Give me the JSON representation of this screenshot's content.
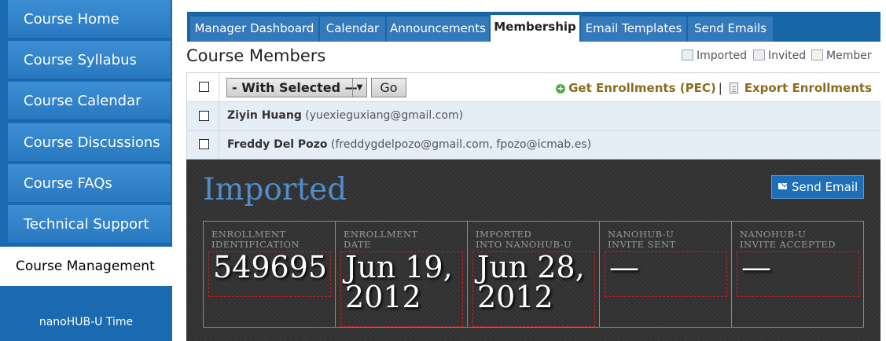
{
  "sidebar": {
    "items": [
      {
        "label": "Course Home"
      },
      {
        "label": "Course Syllabus"
      },
      {
        "label": "Course Calendar"
      },
      {
        "label": "Course Discussions"
      },
      {
        "label": "Course FAQs"
      },
      {
        "label": "Technical Support"
      },
      {
        "label": "Course Management"
      }
    ],
    "footer": "nanoHUB-U Time"
  },
  "tabs": [
    {
      "label": "Manager Dashboard"
    },
    {
      "label": "Calendar"
    },
    {
      "label": "Announcements"
    },
    {
      "label": "Membership"
    },
    {
      "label": "Email Templates"
    },
    {
      "label": "Send Emails"
    }
  ],
  "page": {
    "title": "Course Members",
    "legend": [
      {
        "label": "Imported",
        "color": "#e8eef7"
      },
      {
        "label": "Invited",
        "color": "#efebf5"
      },
      {
        "label": "Member",
        "color": "#f3f3e6"
      }
    ]
  },
  "toolbar": {
    "select_value": "- With Selected —",
    "go_label": "Go",
    "get_enrollments": "Get Enrollments (PEC)",
    "separator": "|",
    "export_enrollments": "Export Enrollments"
  },
  "members": [
    {
      "name": "Ziyin Huang",
      "emails": "(yuexieguxiang@gmail.com)"
    },
    {
      "name": "Freddy Del Pozo",
      "emails": "(freddygdelpozo@gmail.com, fpozo@icmab.es)"
    }
  ],
  "detail": {
    "title": "Imported",
    "send_email_label": "Send Email",
    "fields": [
      {
        "label_1": "ENROLLMENT",
        "label_2": "IDENTIFICATION",
        "value_1": "549695",
        "value_2": ""
      },
      {
        "label_1": "ENROLLMENT",
        "label_2": "DATE",
        "value_1": "Jun 19,",
        "value_2": "2012"
      },
      {
        "label_1": "IMPORTED",
        "label_2": "INTO NANOHUB-U",
        "value_1": "Jun 28,",
        "value_2": "2012"
      },
      {
        "label_1": "NANOHUB-U",
        "label_2": "INVITE SENT",
        "value_1": "—",
        "value_2": ""
      },
      {
        "label_1": "NANOHUB-U",
        "label_2": "INVITE ACCEPTED",
        "value_1": "—",
        "value_2": ""
      }
    ]
  }
}
